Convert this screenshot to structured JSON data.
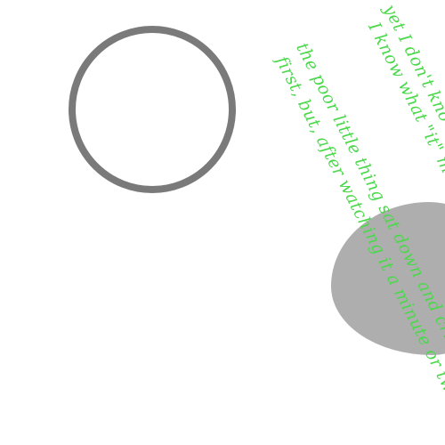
{
  "text_lines": [
    "yet I don't kno",
    "I know what \"it\" m",
    "the poor little thing sat down and crie",
    "first, but, after watching it a minute or two"
  ],
  "colors": {
    "background": "#ffffff",
    "ring": "#7a7a7a",
    "blob": "#aeaeae",
    "text": "#4cd84c"
  }
}
